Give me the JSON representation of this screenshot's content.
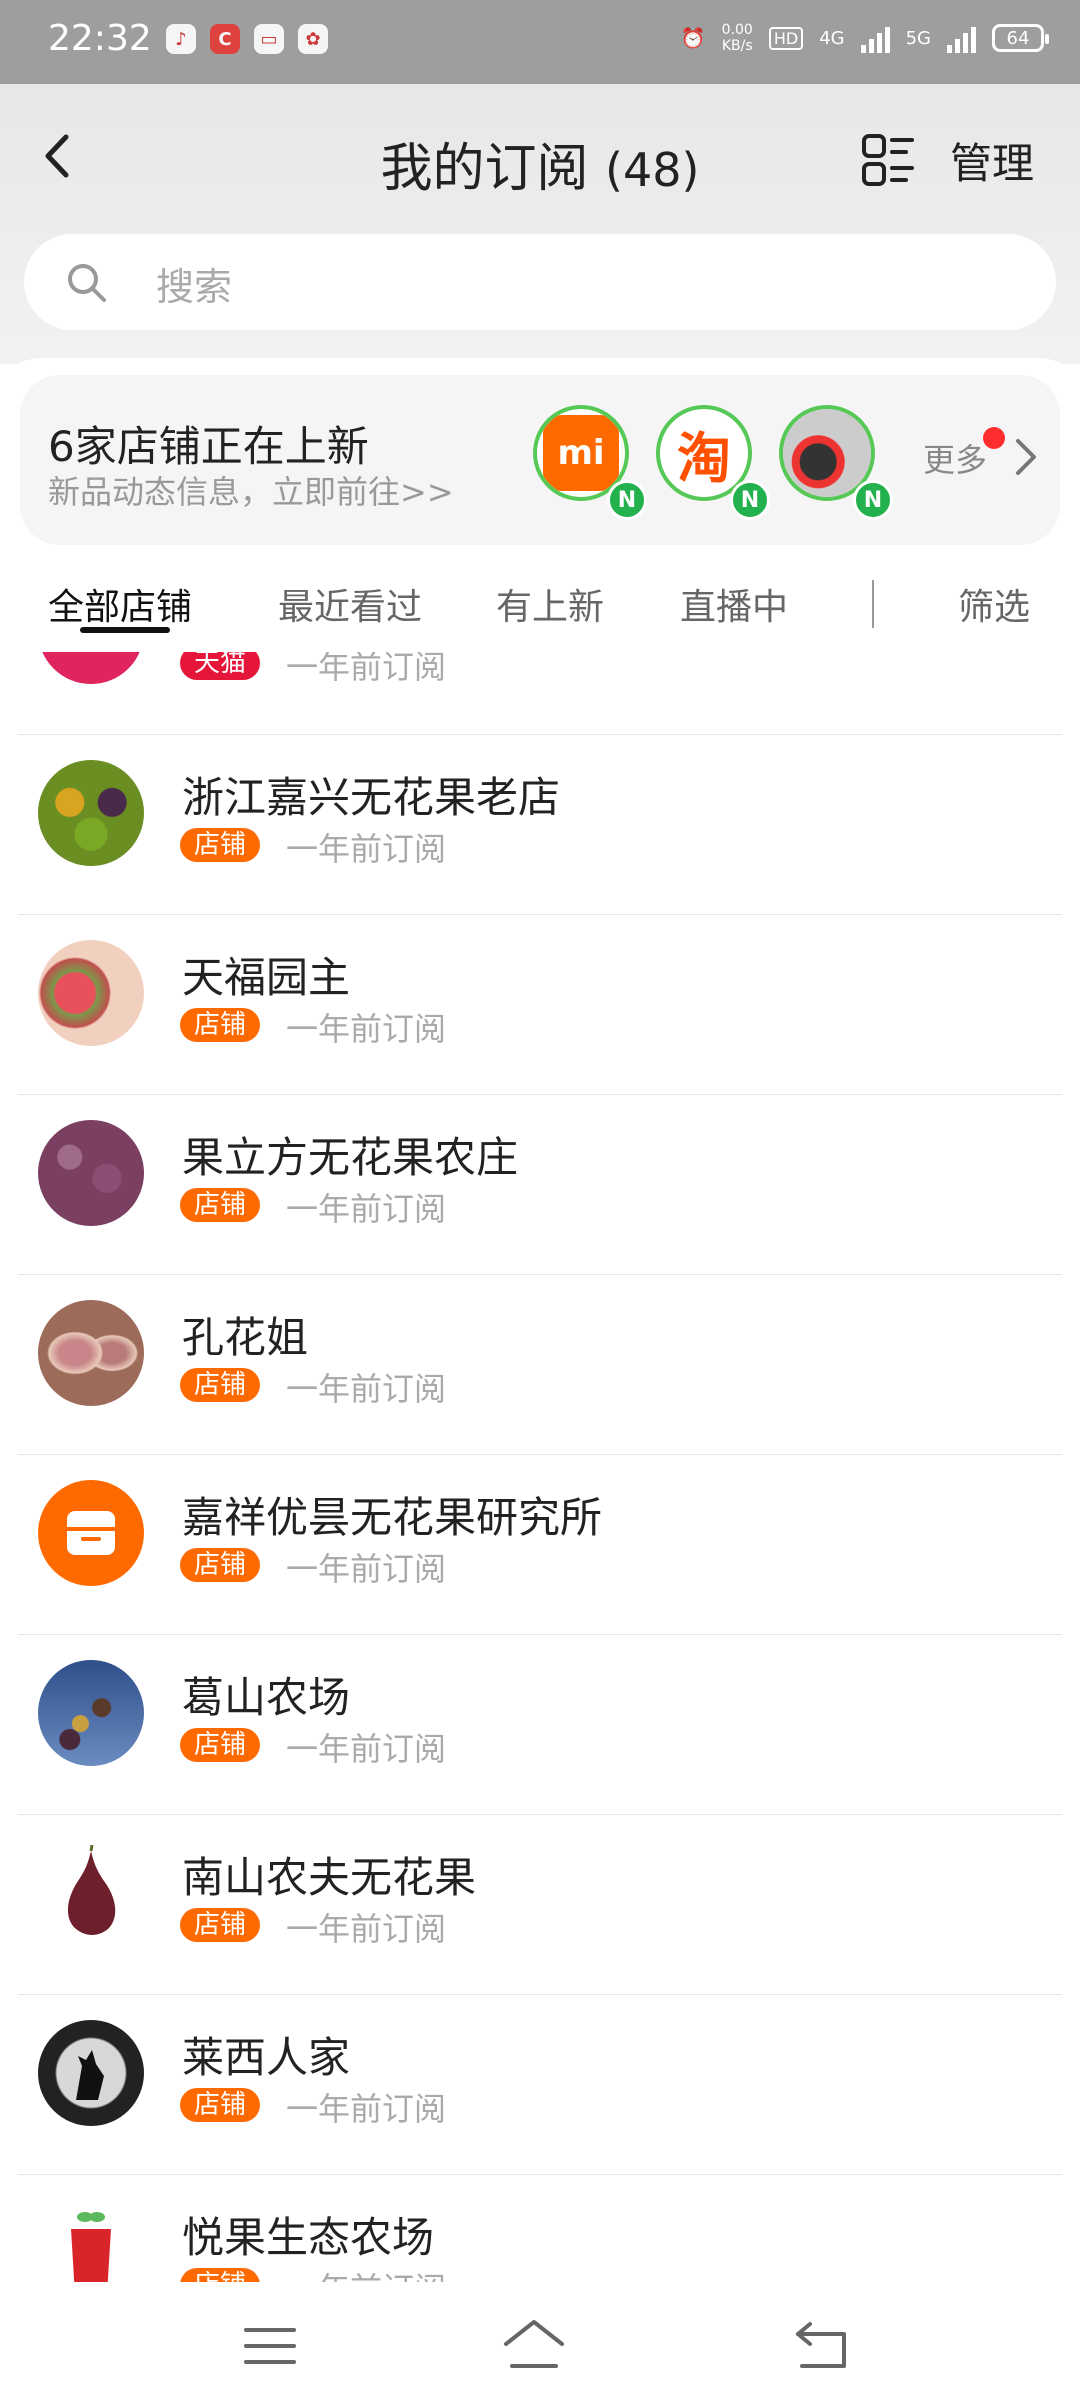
{
  "status_bar": {
    "time": "22:32",
    "net_speed": "0.00",
    "net_unit": "KB/s",
    "hd": "HD",
    "net1": "4G",
    "net2": "5G",
    "battery": "64"
  },
  "header": {
    "title": "我的订阅",
    "count": "(48)",
    "manage_label": "管理"
  },
  "search": {
    "placeholder": "搜索"
  },
  "new_arrivals": {
    "title": "6家店铺正在上新",
    "subtitle": "新品动态信息，立即前往>>",
    "more_label": "更多",
    "shops": [
      {
        "name": "xiaomi",
        "logo_text": "mi"
      },
      {
        "name": "taobao",
        "logo_text": "淘"
      },
      {
        "name": "shoe-store",
        "logo_text": ""
      }
    ],
    "badge": "N"
  },
  "tabs": [
    {
      "label": "全部店铺",
      "active": true
    },
    {
      "label": "最近看过",
      "active": false
    },
    {
      "label": "有上新",
      "active": false
    },
    {
      "label": "直播中",
      "active": false
    }
  ],
  "filter_label": "筛选",
  "subscriptions": [
    {
      "name": "",
      "tag": "天猫",
      "time": "一年前订阅",
      "avatar_color": "#e0245e"
    },
    {
      "name": "浙江嘉兴无花果老店",
      "tag": "店铺",
      "time": "一年前订阅",
      "avatar_color": "#6b8e23"
    },
    {
      "name": "天福园主",
      "tag": "店铺",
      "time": "一年前订阅",
      "avatar_color": "#c0504d"
    },
    {
      "name": "果立方无花果农庄",
      "tag": "店铺",
      "time": "一年前订阅",
      "avatar_color": "#7b3f61"
    },
    {
      "name": "孔花姐",
      "tag": "店铺",
      "time": "一年前订阅",
      "avatar_color": "#9c6b5a"
    },
    {
      "name": "嘉祥优昙无花果研究所",
      "tag": "店铺",
      "time": "一年前订阅",
      "avatar_color": "#ff6a00"
    },
    {
      "name": "葛山农场",
      "tag": "店铺",
      "time": "一年前订阅",
      "avatar_color": "#3b5b8c"
    },
    {
      "name": "南山农夫无花果",
      "tag": "店铺",
      "time": "一年前订阅",
      "avatar_color": "#6d1f2b"
    },
    {
      "name": "莱西人家",
      "tag": "店铺",
      "time": "一年前订阅",
      "avatar_color": "#222222"
    },
    {
      "name": "悦果生态农场",
      "tag": "店铺",
      "time": "一年前订阅",
      "avatar_color": "#d9252a"
    }
  ],
  "colors": {
    "accent": "#ff6a00",
    "tmall": "#e5163a",
    "new_badge": "#22b14c"
  }
}
